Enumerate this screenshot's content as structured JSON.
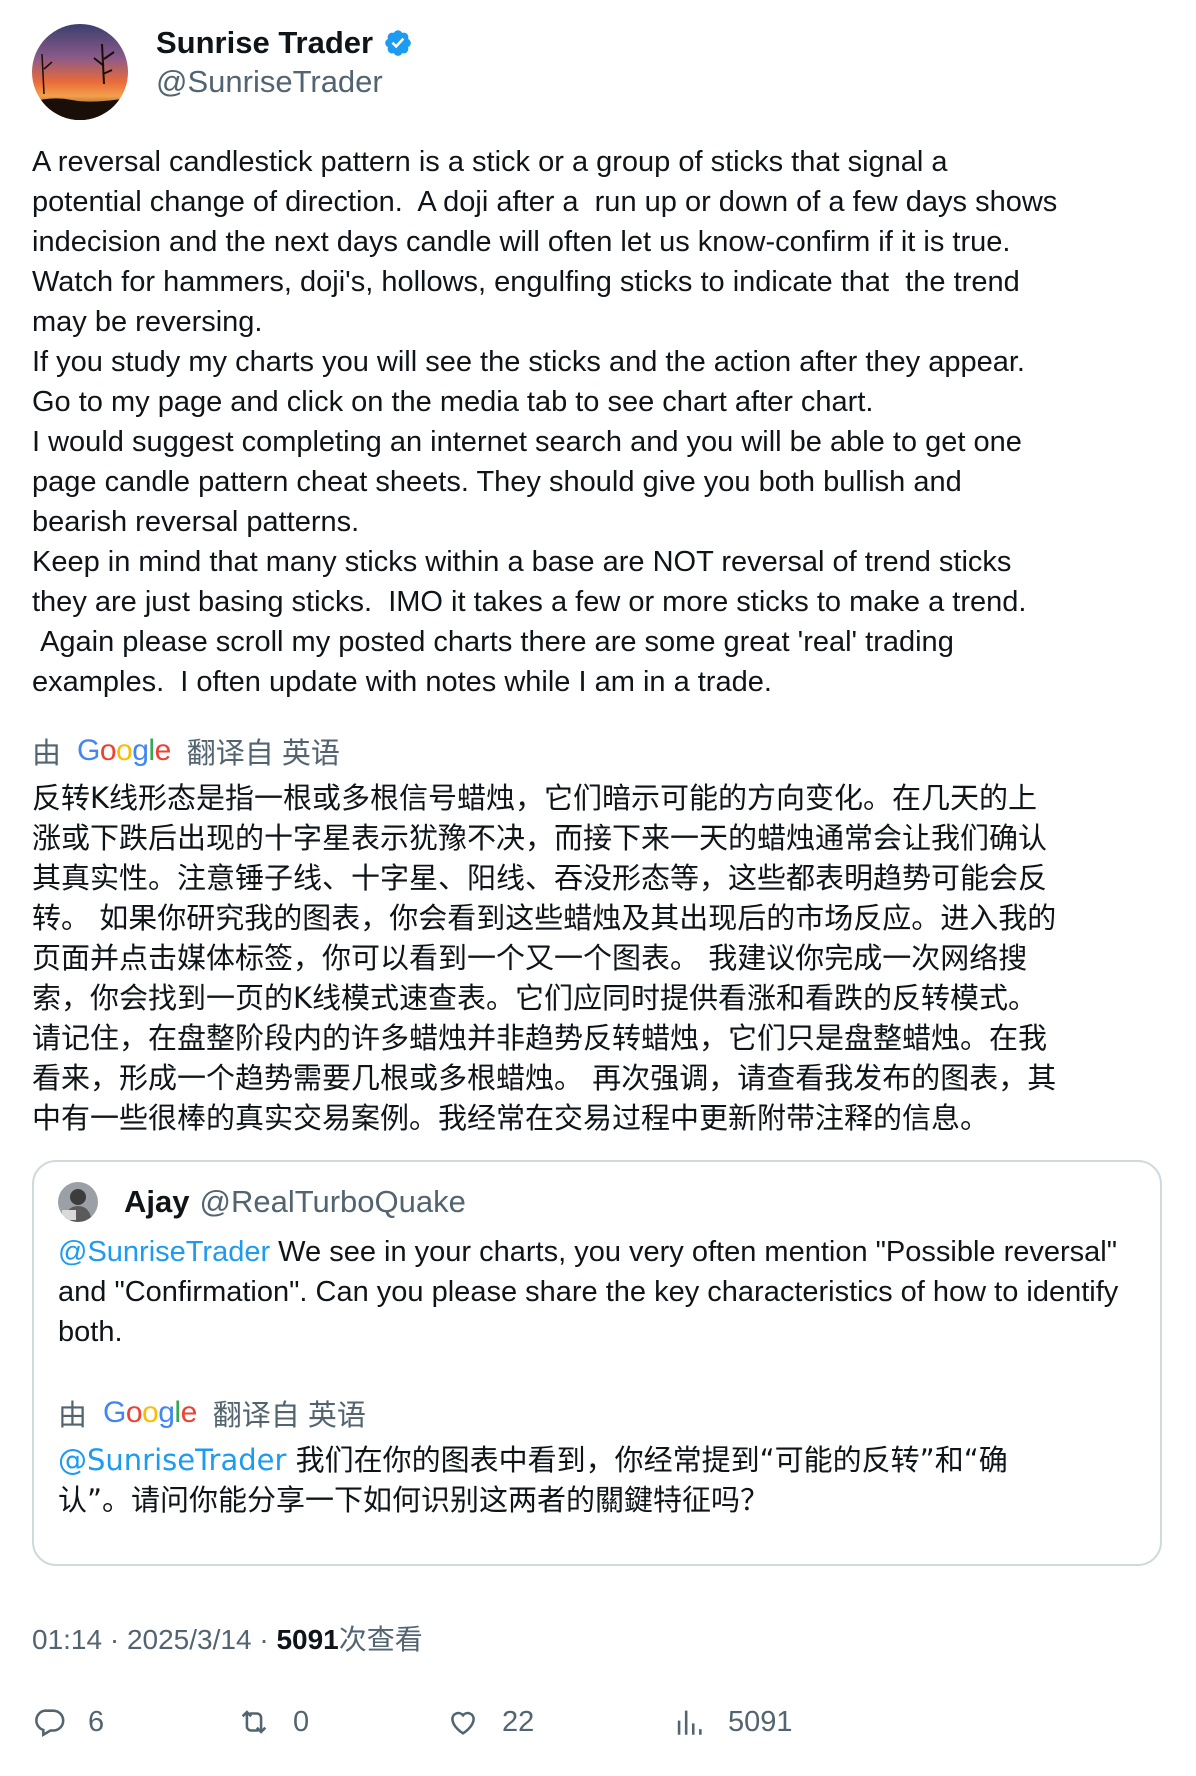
{
  "author": {
    "display_name": "Sunrise Trader",
    "handle": "@SunriseTrader",
    "verified_icon": "verified-badge-icon"
  },
  "tweet": {
    "text": "A reversal candlestick pattern is a stick or a group of sticks that signal a\npotential change of direction.  A doji after a  run up or down of a few days shows\nindecision and the next days candle will often let us know-confirm if it is true.\nWatch for hammers, doji's, hollows, engulfing sticks to indicate that  the trend\nmay be reversing.\nIf you study my charts you will see the sticks and the action after they appear.\nGo to my page and click on the media tab to see chart after chart.\nI would suggest completing an internet search and you will be able to get one\npage candle pattern cheat sheets. They should give you both bullish and\nbearish reversal patterns.\nKeep in mind that many sticks within a base are NOT reversal of trend sticks\nthey are just basing sticks.  IMO it takes a few or more sticks to make a trend.\n Again please scroll my posted charts there are some great 'real' trading\nexamples.  I often update with notes while I am in a trade.",
    "translate_prefix": "由",
    "translate_suffix": "翻译自 英语",
    "translated_text": "反转K线形态是指一根或多根信号蜡烛，它们暗示可能的方向变化。在几天的上\n涨或下跌后出现的十字星表示犹豫不决，而接下来一天的蜡烛通常会让我们确认\n其真实性。注意锤子线、十字星、阳线、吞没形态等，这些都表明趋势可能会反\n转。 如果你研究我的图表，你会看到这些蜡烛及其出现后的市场反应。进入我的\n页面并点击媒体标签，你可以看到一个又一个图表。 我建议你完成一次网络搜\n索，你会找到一页的K线模式速查表。它们应同时提供看涨和看跌的反转模式。\n请记住，在盘整阶段内的许多蜡烛并非趋势反转蜡烛，它们只是盘整蜡烛。在我\n看来，形成一个趋势需要几根或多根蜡烛。 再次强调，请查看我发布的图表，其\n中有一些很棒的真实交易案例。我经常在交易过程中更新附带注释的信息。"
  },
  "google_logo": {
    "letters": [
      "G",
      "o",
      "o",
      "g",
      "l",
      "e"
    ],
    "colors": [
      "#4285F4",
      "#EA4335",
      "#FBBC05",
      "#4285F4",
      "#34A853",
      "#EA4335"
    ]
  },
  "quote": {
    "display_name": "Ajay",
    "handle": "@RealTurboQuake",
    "mention": "@SunriseTrader",
    "text": " We see in your charts, you very often mention \"Possible reversal\" and \"Confirmation\". Can you please share the key characteristics of how to identify both.",
    "translate_prefix": "由",
    "translate_suffix": "翻译自 英语",
    "translated_mention": "@SunriseTrader",
    "translated_text": " 我们在你的图表中看到，你经常提到“可能的反转”和“确认”。请问你能分享一下如何识别这两者的關鍵特征吗？"
  },
  "meta": {
    "time": "01:14",
    "sep1": " · ",
    "date": "2025/3/14",
    "sep2": " · ",
    "views": "5091",
    "views_label": "次查看"
  },
  "actions": {
    "replies": "6",
    "retweets": "0",
    "likes": "22",
    "views": "5091"
  },
  "colors": {
    "accent": "#1d9bf0",
    "muted": "#536471",
    "text": "#0f1419",
    "border": "#cfd9de"
  }
}
